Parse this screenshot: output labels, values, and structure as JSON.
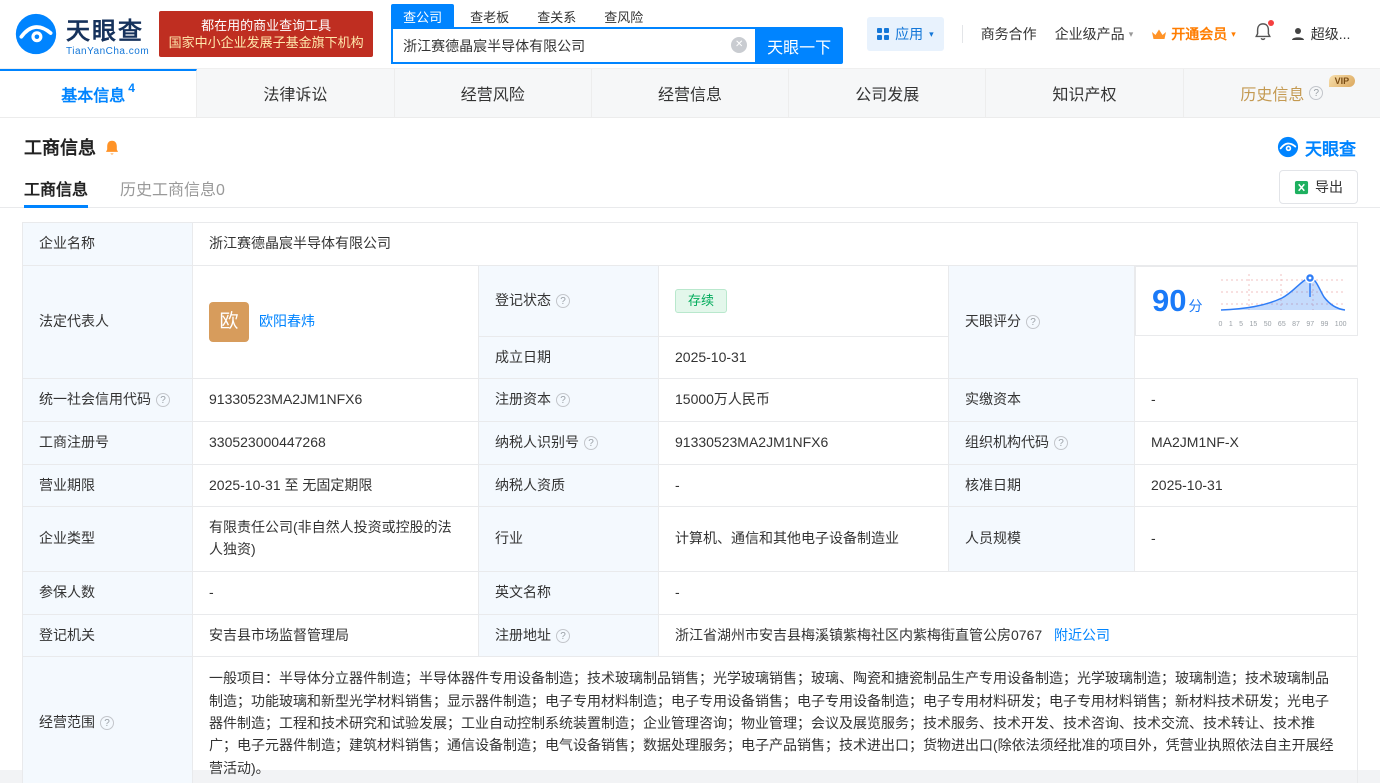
{
  "colors": {
    "brand": "#0084ff",
    "vip_orange": "#ff7d00",
    "status_green": "#00ab5b",
    "promo_red": "#bf2e21",
    "gold": "#c49a52"
  },
  "header": {
    "logo": {
      "cn": "天眼查",
      "en": "TianYanCha.com"
    },
    "promo": {
      "line1": "都在用的商业查询工具",
      "line2": "国家中小企业发展子基金旗下机构"
    },
    "search": {
      "tabs": [
        {
          "label": "查公司"
        },
        {
          "label": "查老板"
        },
        {
          "label": "查关系"
        },
        {
          "label": "查风险"
        }
      ],
      "value": "浙江赛德晶宸半导体有限公司",
      "button": "天眼一下"
    },
    "nav": {
      "apps": "应用",
      "coop": "商务合作",
      "enterprise": "企业级产品",
      "vip": "开通会员",
      "user": "超级..."
    }
  },
  "main_tabs": [
    {
      "label": "基本信息",
      "badge": "4"
    },
    {
      "label": "法律诉讼"
    },
    {
      "label": "经营风险"
    },
    {
      "label": "经营信息"
    },
    {
      "label": "公司发展"
    },
    {
      "label": "知识产权"
    },
    {
      "label": "历史信息",
      "vip_badge": "VIP"
    }
  ],
  "section": {
    "title": "工商信息",
    "brand": "天眼查",
    "subtabs": [
      {
        "label": "工商信息"
      },
      {
        "label": "历史工商信息0"
      }
    ],
    "export": "导出"
  },
  "info": {
    "company_name": {
      "label": "企业名称",
      "value": "浙江赛德晶宸半导体有限公司"
    },
    "legal_rep": {
      "label": "法定代表人",
      "avatar": "欧",
      "name": "欧阳春炜"
    },
    "reg_status": {
      "label": "登记状态",
      "value": "存续"
    },
    "establish_date": {
      "label": "成立日期",
      "value": "2025-10-31"
    },
    "score": {
      "label": "天眼评分",
      "value": "90",
      "unit": "分",
      "axis": [
        "0",
        "1",
        "5",
        "15",
        "50",
        "65",
        "87",
        "97",
        "99",
        "100"
      ]
    },
    "credit_code": {
      "label": "统一社会信用代码",
      "value": "91330523MA2JM1NFX6"
    },
    "reg_capital": {
      "label": "注册资本",
      "value": "15000万人民币"
    },
    "paid_capital": {
      "label": "实缴资本",
      "value": "-"
    },
    "reg_number": {
      "label": "工商注册号",
      "value": "330523000447268"
    },
    "taxpayer_id": {
      "label": "纳税人识别号",
      "value": "91330523MA2JM1NFX6"
    },
    "org_code": {
      "label": "组织机构代码",
      "value": "MA2JM1NF-X"
    },
    "business_term": {
      "label": "营业期限",
      "value": "2025-10-31 至 无固定期限"
    },
    "taxpayer_quality": {
      "label": "纳税人资质",
      "value": "-"
    },
    "approval_date": {
      "label": "核准日期",
      "value": "2025-10-31"
    },
    "company_type": {
      "label": "企业类型",
      "value": "有限责任公司(非自然人投资或控股的法人独资)"
    },
    "industry": {
      "label": "行业",
      "value": "计算机、通信和其他电子设备制造业"
    },
    "staff_size": {
      "label": "人员规模",
      "value": "-"
    },
    "insured_count": {
      "label": "参保人数",
      "value": "-"
    },
    "english_name": {
      "label": "英文名称",
      "value": "-"
    },
    "reg_authority": {
      "label": "登记机关",
      "value": "安吉县市场监督管理局"
    },
    "reg_address": {
      "label": "注册地址",
      "value": "浙江省湖州市安吉县梅溪镇紫梅社区内紫梅街直管公房0767",
      "link": "附近公司"
    },
    "business_scope": {
      "label": "经营范围",
      "value": "一般项目：半导体分立器件制造；半导体器件专用设备制造；技术玻璃制品销售；光学玻璃销售；玻璃、陶瓷和搪瓷制品生产专用设备制造；光学玻璃制造；玻璃制造；技术玻璃制品制造；功能玻璃和新型光学材料销售；显示器件制造；电子专用材料制造；电子专用设备销售；电子专用设备制造；电子专用材料研发；电子专用材料销售；新材料技术研发；光电子器件制造；工程和技术研究和试验发展；工业自动控制系统装置制造；企业管理咨询；物业管理；会议及展览服务；技术服务、技术开发、技术咨询、技术交流、技术转让、技术推广；电子元器件制造；建筑材料销售；通信设备制造；电气设备销售；数据处理服务；电子产品销售；技术进出口；货物进出口(除依法须经批准的项目外，凭营业执照依法自主开展经营活动)。"
    }
  }
}
